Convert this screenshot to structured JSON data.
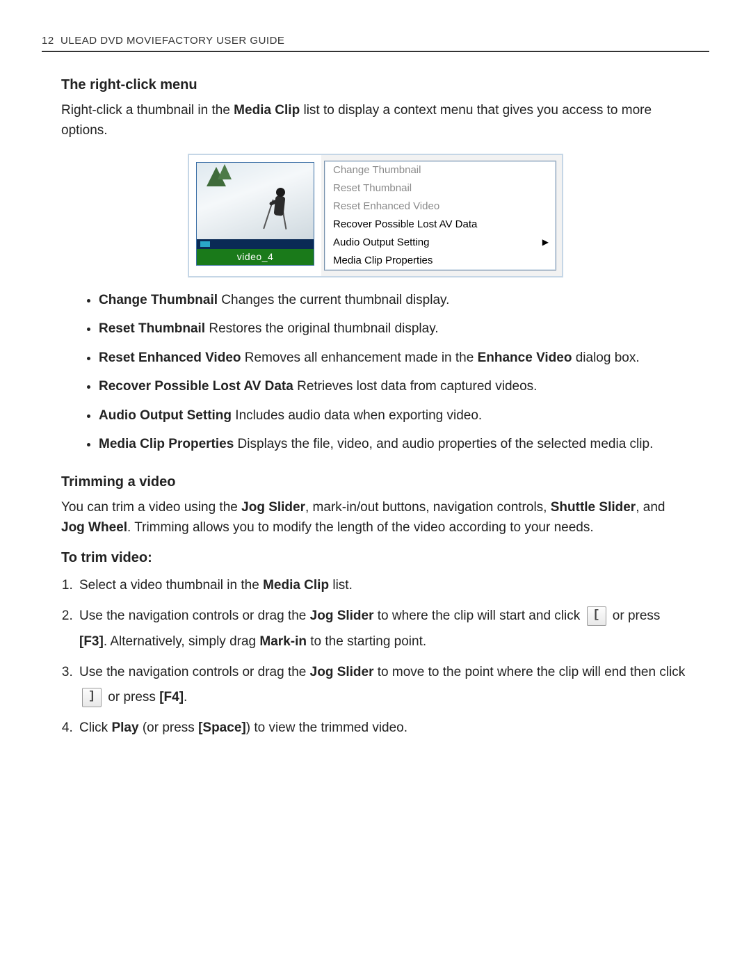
{
  "header": {
    "page_number": "12",
    "running_title": "ULEAD DVD MOVIEFACTORY USER GUIDE"
  },
  "sections": {
    "rcm_title": "The right-click menu",
    "rcm_intro_pre": "Right-click a thumbnail in the ",
    "rcm_intro_bold": "Media Clip",
    "rcm_intro_post": " list to display a context menu that gives you access to more options.",
    "trim_title": "Trimming a video",
    "trim_intro": {
      "p1a": "You can trim a video using the ",
      "b1": "Jog Slider",
      "p1b": ", mark-in/out buttons, navigation controls, ",
      "b2": "Shuttle Slider",
      "p1c": ", and ",
      "b3": "Jog Wheel",
      "p1d": ". Trimming allows you to modify the length of the video according to your needs."
    },
    "trim_howto_title": "To trim video:"
  },
  "figure": {
    "thumb_caption": "video_4",
    "menu_items": [
      {
        "label": "Change Thumbnail",
        "enabled": false,
        "submenu": false
      },
      {
        "label": "Reset Thumbnail",
        "enabled": false,
        "submenu": false
      },
      {
        "label": "Reset Enhanced Video",
        "enabled": false,
        "submenu": false
      },
      {
        "label": "Recover Possible Lost AV Data",
        "enabled": true,
        "submenu": false
      },
      {
        "label": "Audio Output Setting",
        "enabled": true,
        "submenu": true
      },
      {
        "label": "Media Clip Properties",
        "enabled": true,
        "submenu": false
      }
    ]
  },
  "bullets": [
    {
      "term": "Change Thumbnail",
      "desc": " Changes the current thumbnail display."
    },
    {
      "term": "Reset Thumbnail",
      "desc": " Restores the original thumbnail display."
    },
    {
      "term": "Reset Enhanced Video",
      "desc_a": " Removes all enhancement made in the ",
      "desc_bold": "Enhance Video",
      "desc_b": " dialog box."
    },
    {
      "term": "Recover Possible Lost AV Data",
      "desc": " Retrieves lost data from captured videos."
    },
    {
      "term": "Audio Output Setting",
      "desc": " Includes audio data when exporting video."
    },
    {
      "term": "Media Clip Properties",
      "desc": " Displays the file, video, and audio properties of the selected media clip."
    }
  ],
  "steps": {
    "s1_a": "Select a video thumbnail in the ",
    "s1_b": "Media Clip",
    "s1_c": " list.",
    "s2_a": "Use the navigation controls or drag the ",
    "s2_b": "Jog Slider",
    "s2_c": " to where the clip will start and click ",
    "s2_icon": "[",
    "s2_d": " or press ",
    "s2_e": "[F3]",
    "s2_f": ". Alternatively, simply drag ",
    "s2_g": "Mark-in",
    "s2_h": " to the starting point.",
    "s3_a": "Use the navigation controls or drag the ",
    "s3_b": "Jog Slider",
    "s3_c": " to move to the point where the clip will end then click ",
    "s3_icon": "]",
    "s3_d": " or press ",
    "s3_e": "[F4]",
    "s3_f": ".",
    "s4_a": "Click ",
    "s4_b": "Play",
    "s4_c": " (or press ",
    "s4_d": "[Space]",
    "s4_e": ") to view the trimmed video."
  }
}
